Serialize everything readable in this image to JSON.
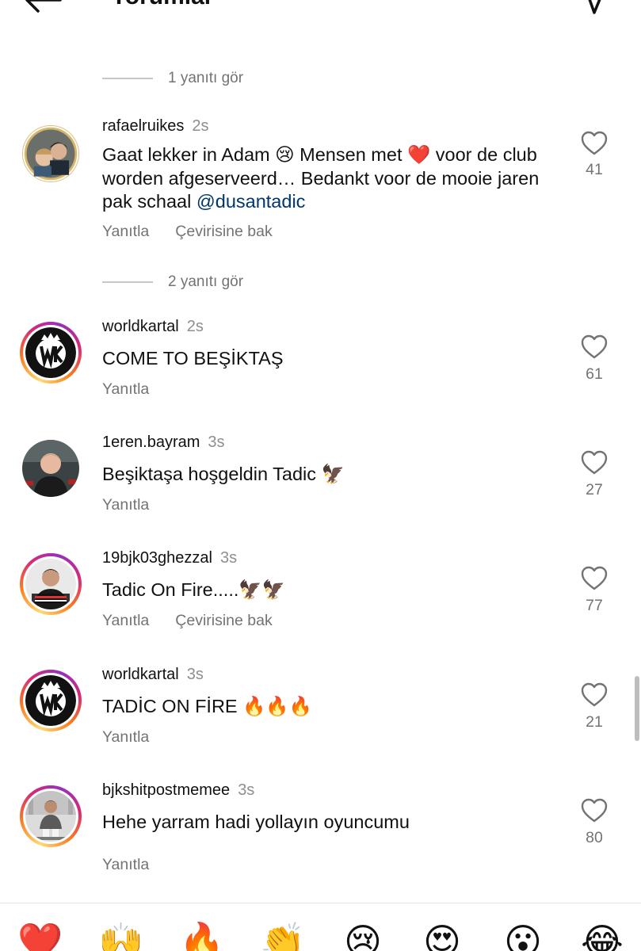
{
  "header": {
    "title": "Yorumlar"
  },
  "reply_toggles": [
    {
      "label": "1 yanıtı gör"
    },
    {
      "label": "2 yanıtı gör"
    }
  ],
  "comments": [
    {
      "username": "rafaelruikes",
      "time": "2s",
      "text_parts": [
        "Gaat lekker in Adam 😢 Mensen met ❤️ voor de club worden afgeserveerd… Bedankt voor de mooie jaren pak schaal ",
        "@dusantadic"
      ],
      "reply": "Yanıtla",
      "translate": "Çevirisine bak",
      "likes": "41"
    },
    {
      "username": "worldkartal",
      "time": "2s",
      "text": "COME TO BEŞİKTAŞ",
      "reply": "Yanıtla",
      "likes": "61"
    },
    {
      "username": "1eren.bayram",
      "time": "3s",
      "text": "Beşiktaşa hoşgeldin Tadic 🦅",
      "reply": "Yanıtla",
      "likes": "27"
    },
    {
      "username": "19bjk03ghezzal",
      "time": "3s",
      "text": "Tadic On Fire.....🦅🦅",
      "reply": "Yanıtla",
      "translate": "Çevirisine bak",
      "likes": "77"
    },
    {
      "username": "worldkartal",
      "time": "3s",
      "text": "TADİC ON FİRE 🔥🔥🔥",
      "reply": "Yanıtla",
      "likes": "21"
    },
    {
      "username": "bjkshitpostmemee",
      "time": "3s",
      "text": "Hehe yarram hadi yollayın oyuncumu",
      "reply": "Yanıtla",
      "likes": "80"
    }
  ],
  "emoji_bar": [
    "❤️",
    "🙌",
    "🔥",
    "👏",
    "😢",
    "😍",
    "😮",
    "😂"
  ]
}
